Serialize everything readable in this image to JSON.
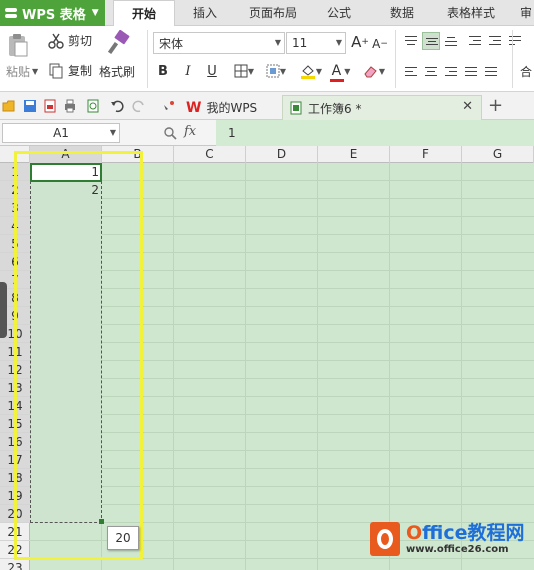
{
  "app": {
    "name": "WPS 表格"
  },
  "menu": {
    "tabs": [
      "开始",
      "插入",
      "页面布局",
      "公式",
      "数据",
      "表格样式",
      "审"
    ],
    "active": "开始"
  },
  "ribbon": {
    "paste": "粘贴",
    "cut": "剪切",
    "copy": "复制",
    "format_painter": "格式刷",
    "font_name": "宋体",
    "font_size": "11",
    "bold": "B",
    "italic": "I",
    "underline": "U",
    "grow_font": "A",
    "shrink_font": "A",
    "font_color_letter": "A",
    "wrap_label": "合"
  },
  "tabs": {
    "my_wps": "我的WPS",
    "workbook": "工作簿6 *"
  },
  "formula_bar": {
    "name_box": "A1",
    "fx": "fx",
    "value": "1"
  },
  "sheet": {
    "columns": [
      "A",
      "B",
      "C",
      "D",
      "E",
      "F",
      "G"
    ],
    "rows": [
      "1",
      "2",
      "3",
      "4",
      "5",
      "6",
      "7",
      "8",
      "9",
      "10",
      "11",
      "12",
      "13",
      "14",
      "15",
      "16",
      "17",
      "18",
      "19",
      "20",
      "21",
      "22",
      "23"
    ],
    "cells": {
      "A1": "1",
      "A2": "2"
    },
    "fill_tooltip": "20"
  },
  "watermark": {
    "title_o": "O",
    "title_rest": "ffice教程网",
    "url": "www.office26.com"
  },
  "colors": {
    "brand": "#4ea33b",
    "sheet_bg": "#cfe7cf",
    "highlight": "#f2f23a",
    "active_border": "#2e7d32",
    "watermark_orange": "#e95a1f",
    "watermark_blue": "#1f6fd8"
  }
}
